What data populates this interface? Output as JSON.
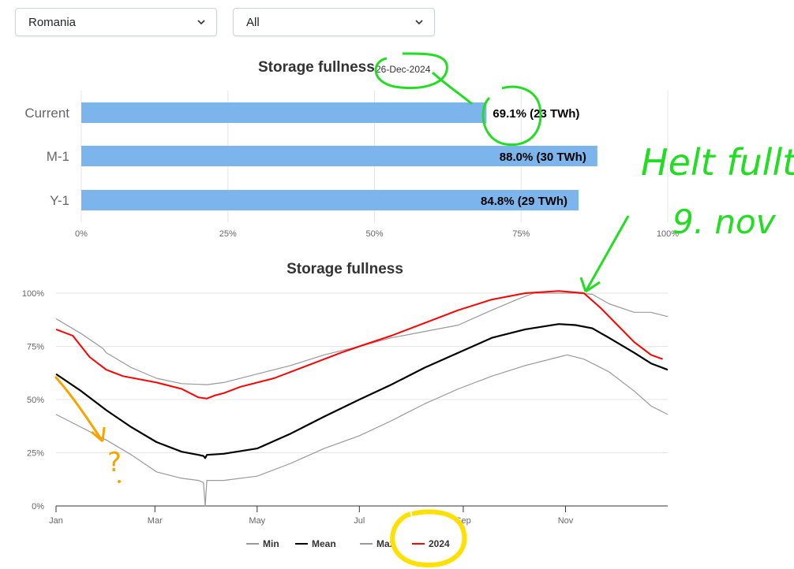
{
  "filters": {
    "country": "Romania",
    "type": "All"
  },
  "chart_data": [
    {
      "type": "bar",
      "orientation": "horizontal",
      "title": "Storage fullness",
      "subtitle": "26-Dec-2024",
      "categories": [
        "Current",
        "M-1",
        "Y-1"
      ],
      "values": [
        69.1,
        88.0,
        84.8
      ],
      "labels": [
        "69.1% (23 TWh)",
        "88.0% (30 TWh)",
        "84.8% (29 TWh)"
      ],
      "xlim": [
        0,
        100
      ],
      "xticks": [
        "0%",
        "25%",
        "50%",
        "75%",
        "100%"
      ],
      "bar_color": "#7cb5ec",
      "grid": true
    },
    {
      "type": "line",
      "title": "Storage fullness",
      "x_label_ticks": [
        "Jan",
        "Mar",
        "May",
        "Jul",
        "Sep",
        "Nov"
      ],
      "x_tick_days": [
        0,
        59,
        120,
        181,
        243,
        304
      ],
      "yticks": [
        "0%",
        "25%",
        "50%",
        "75%",
        "100%"
      ],
      "ylim": [
        0,
        100
      ],
      "legend_position": "bottom",
      "series": [
        {
          "name": "Min",
          "color": "#999999",
          "points": [
            [
              0,
              43
            ],
            [
              15,
              37
            ],
            [
              30,
              31
            ],
            [
              45,
              24
            ],
            [
              60,
              16
            ],
            [
              75,
              13
            ],
            [
              85,
              12
            ],
            [
              88,
              11
            ],
            [
              89,
              0
            ],
            [
              90,
              12
            ],
            [
              100,
              12
            ],
            [
              120,
              14
            ],
            [
              140,
              20
            ],
            [
              160,
              27
            ],
            [
              181,
              33
            ],
            [
              200,
              40
            ],
            [
              220,
              48
            ],
            [
              240,
              55
            ],
            [
              260,
              61
            ],
            [
              280,
              66
            ],
            [
              300,
              70
            ],
            [
              305,
              71
            ],
            [
              315,
              69
            ],
            [
              330,
              63
            ],
            [
              345,
              54
            ],
            [
              355,
              47
            ],
            [
              365,
              43
            ]
          ]
        },
        {
          "name": "Mean",
          "color": "#000000",
          "points": [
            [
              0,
              62
            ],
            [
              15,
              54
            ],
            [
              30,
              45
            ],
            [
              45,
              37
            ],
            [
              60,
              30
            ],
            [
              75,
              25.5
            ],
            [
              85,
              24
            ],
            [
              88,
              23.5
            ],
            [
              89,
              22.5
            ],
            [
              90,
              24
            ],
            [
              100,
              24.5
            ],
            [
              120,
              27
            ],
            [
              140,
              34
            ],
            [
              160,
              42
            ],
            [
              181,
              50
            ],
            [
              200,
              57
            ],
            [
              220,
              65
            ],
            [
              240,
              72
            ],
            [
              260,
              79
            ],
            [
              280,
              83
            ],
            [
              300,
              85.5
            ],
            [
              310,
              85
            ],
            [
              320,
              83.5
            ],
            [
              330,
              79
            ],
            [
              345,
              72
            ],
            [
              355,
              67
            ],
            [
              365,
              64
            ]
          ]
        },
        {
          "name": "Max",
          "color": "#999999",
          "points": [
            [
              0,
              88
            ],
            [
              15,
              81
            ],
            [
              28,
              74
            ],
            [
              30,
              72
            ],
            [
              45,
              65
            ],
            [
              60,
              60
            ],
            [
              75,
              57.5
            ],
            [
              90,
              57
            ],
            [
              100,
              58
            ],
            [
              120,
              62
            ],
            [
              140,
              66
            ],
            [
              160,
              71
            ],
            [
              181,
              75
            ],
            [
              200,
              79
            ],
            [
              220,
              82
            ],
            [
              240,
              85
            ],
            [
              260,
              92
            ],
            [
              275,
              97
            ],
            [
              285,
              100
            ],
            [
              310,
              100
            ],
            [
              320,
              99.5
            ],
            [
              330,
              95
            ],
            [
              345,
              91
            ],
            [
              355,
              91
            ],
            [
              365,
              89
            ]
          ]
        },
        {
          "name": "2024",
          "color": "#ff0000",
          "points": [
            [
              0,
              83
            ],
            [
              10,
              80
            ],
            [
              20,
              70
            ],
            [
              30,
              64
            ],
            [
              40,
              61
            ],
            [
              60,
              58
            ],
            [
              75,
              55
            ],
            [
              85,
              51
            ],
            [
              90,
              50.5
            ],
            [
              95,
              52
            ],
            [
              100,
              53
            ],
            [
              110,
              56
            ],
            [
              130,
              60
            ],
            [
              150,
              66
            ],
            [
              170,
              72
            ],
            [
              181,
              75
            ],
            [
              200,
              80
            ],
            [
              220,
              86
            ],
            [
              240,
              92
            ],
            [
              260,
              97
            ],
            [
              280,
              100
            ],
            [
              300,
              101
            ],
            [
              315,
              100
            ],
            [
              325,
              93
            ],
            [
              335,
              85
            ],
            [
              345,
              77
            ],
            [
              355,
              71
            ],
            [
              362,
              69
            ]
          ]
        }
      ]
    }
  ],
  "annotations": {
    "handwritten_text_line1": "Helt fullt",
    "handwritten_text_line2": "9. nov",
    "question_mark": "?"
  }
}
